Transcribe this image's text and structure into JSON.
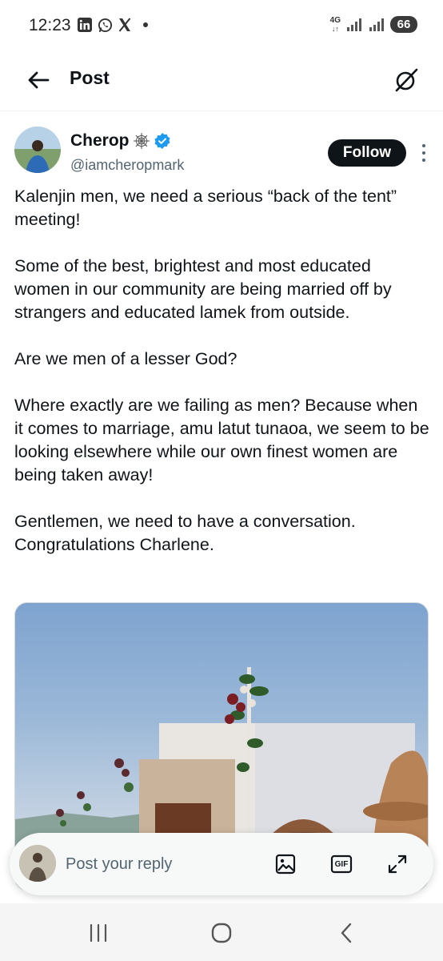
{
  "status": {
    "time": "12:23",
    "network": "4G",
    "battery": "66",
    "icons": [
      "linkedin-icon",
      "whatsapp-icon",
      "x-icon"
    ]
  },
  "header": {
    "title": "Post"
  },
  "author": {
    "name": "Cherop",
    "name_emoji": "spiderweb-icon",
    "handle": "@iamcheropmark",
    "verified": true,
    "follow_label": "Follow"
  },
  "tweet": {
    "paragraphs": [
      "Kalenjin men, we need a serious “back of the tent” meeting!",
      "Some of the best, brightest and most educated women in our community are being married off by strangers and educated lamek from outside.",
      "Are we men of a lesser God?",
      "Where exactly are we failing as men? Because when it comes to marriage, amu latut tunaoa, we seem to be looking elsewhere while our own finest women are being taken away!",
      "Gentlemen, we need to have a conversation. Congratulations Charlene."
    ]
  },
  "reply": {
    "placeholder": "Post your reply",
    "gif_label": "GIF"
  },
  "colors": {
    "text": "#0f1419",
    "secondary": "#536471",
    "verified": "#1d9bf0",
    "follow_bg": "#0f1419"
  }
}
